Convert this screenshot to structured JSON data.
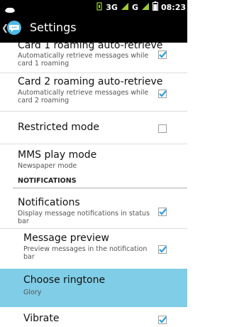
{
  "status_bar": {
    "left_icon": "notification-icon",
    "network_1": "3G",
    "network_2": "G",
    "time": "08:23",
    "signal_icon": "signal-icon",
    "battery_icon": "battery-icon"
  },
  "action_bar": {
    "back_icon": "chevron-left-icon",
    "app_icon": "messaging-icon",
    "title": "Settings"
  },
  "items": [
    {
      "title": "Card 1 roaming auto-retrieve",
      "summary": "Automatically retrieve messages while card 1 roaming",
      "checked": true
    },
    {
      "title": "Card 2 roaming auto-retrieve",
      "summary": "Automatically retrieve messages while card 2 roaming",
      "checked": true
    },
    {
      "title": "Restricted mode",
      "summary": "",
      "checked": false
    },
    {
      "title": "MMS play mode",
      "summary": "Newspaper mode"
    }
  ],
  "notifications_section": {
    "header": "NOTIFICATIONS",
    "items": [
      {
        "title": "Notifications",
        "summary": "Display message notifications in status bar",
        "checked": true
      },
      {
        "title": "Message preview",
        "summary": "Preview messages in the notification bar",
        "checked": true
      },
      {
        "title": "Choose ringtone",
        "summary": "Glory",
        "selected": true
      },
      {
        "title": "Vibrate",
        "checked": true
      }
    ]
  },
  "colors": {
    "accent": "#2e9fd8",
    "selected": "#7fcde7",
    "status_signal": "#9ccc36"
  }
}
